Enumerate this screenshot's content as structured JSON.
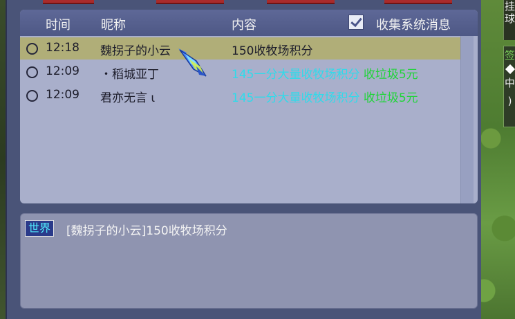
{
  "right_tabs": {
    "tab1": "挂\n球",
    "tab2_top": "签",
    "tab2_mid": "中",
    "tab2_bottom": ")"
  },
  "list": {
    "headers": {
      "time": "时间",
      "nickname": "昵称",
      "content": "内容",
      "collect_system": "收集系统消息"
    },
    "collect_system_checked": true,
    "rows": [
      {
        "time": "12:18",
        "nickname": "魏拐子的小云",
        "content_parts": [
          {
            "text": "150收牧场积分",
            "color": "default"
          }
        ],
        "selected": true
      },
      {
        "time": "12:09",
        "nickname": "・稻城亚丁",
        "content_parts": [
          {
            "text": "145一分大量收牧场积分 ",
            "color": "cyan"
          },
          {
            "text": "收垃圾5元",
            "color": "green"
          }
        ],
        "selected": false
      },
      {
        "time": "12:09",
        "nickname": "君亦无言 ι",
        "content_parts": [
          {
            "text": "145一分大量收牧场积分 ",
            "color": "cyan"
          },
          {
            "text": "收垃圾5元",
            "color": "green"
          }
        ],
        "selected": false
      }
    ]
  },
  "detail": {
    "channel": "世界",
    "text": "[魏拐子的小云]150收牧场积分"
  },
  "colors": {
    "panel": "#4a5478",
    "list_bg": "#a9afcb",
    "selected_row": "#b0ae78",
    "cyan_text": "#2fdbea",
    "green_text": "#21d43a"
  },
  "icons": {
    "cursor": "crystal-pointer-cursor-icon"
  }
}
